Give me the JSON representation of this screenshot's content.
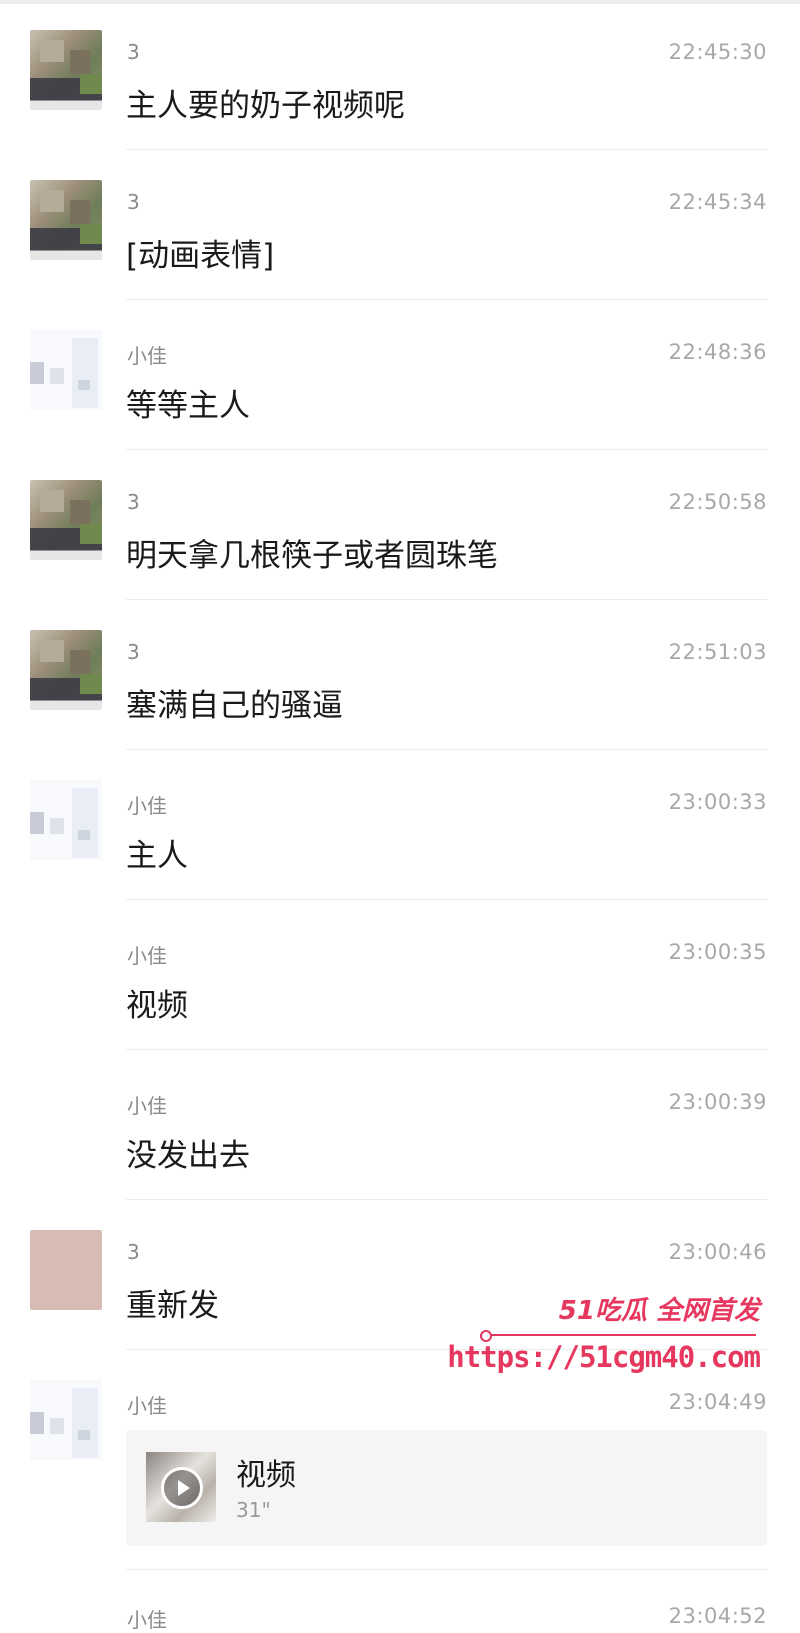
{
  "messages": [
    {
      "sender": "3",
      "time": "22:45:30",
      "text": "主人要的奶子视频呢",
      "avatar": "user3"
    },
    {
      "sender": "3",
      "time": "22:45:34",
      "text": "[动画表情]",
      "avatar": "user3"
    },
    {
      "sender": "小佳",
      "time": "22:48:36",
      "text": "等等主人",
      "avatar": "xiaojia"
    },
    {
      "sender": "3",
      "time": "22:50:58",
      "text": "明天拿几根筷子或者圆珠笔",
      "avatar": "user3"
    },
    {
      "sender": "3",
      "time": "22:51:03",
      "text": "塞满自己的骚逼",
      "avatar": "user3"
    },
    {
      "sender": "小佳",
      "time": "23:00:33",
      "text": "主人",
      "avatar": "xiaojia"
    },
    {
      "sender": "小佳",
      "time": "23:00:35",
      "text": "视频",
      "avatar": "none"
    },
    {
      "sender": "小佳",
      "time": "23:00:39",
      "text": "没发出去",
      "avatar": "none"
    },
    {
      "sender": "3",
      "time": "23:00:46",
      "text": "重新发",
      "avatar": "pink"
    },
    {
      "sender": "小佳",
      "time": "23:04:49",
      "avatar": "xiaojia",
      "video": {
        "title": "视频",
        "duration": "31\""
      }
    },
    {
      "sender": "小佳",
      "time": "23:04:52",
      "avatar": "none"
    }
  ],
  "watermark": {
    "title": "51吃瓜 全网首发",
    "url": "https://51cgm40.com"
  }
}
